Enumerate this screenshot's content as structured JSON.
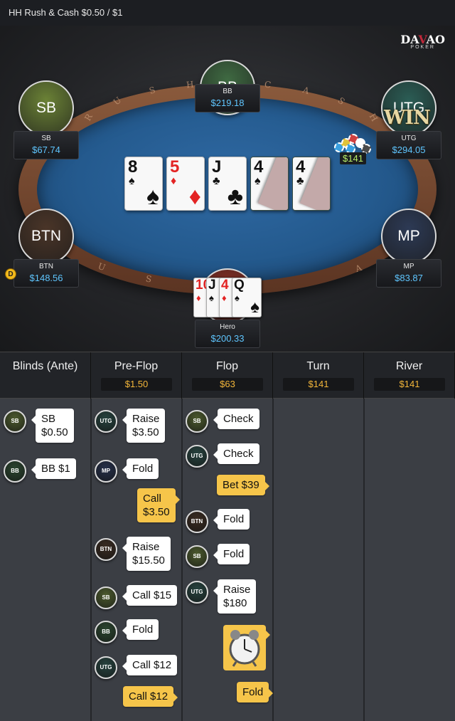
{
  "header": {
    "title": "HH  Rush & Cash $0.50 / $1"
  },
  "logo": {
    "brand_pre": "DA",
    "brand_o": "V",
    "brand_post": "AO",
    "subtitle": "POKER"
  },
  "table": {
    "rail_letters": [
      "R",
      "U",
      "S",
      "H",
      "&",
      "C",
      "A",
      "S",
      "H",
      "U",
      "S",
      "A"
    ],
    "seats": [
      {
        "id": "bb",
        "label": "BB",
        "name": "BB",
        "stack": "$219.18",
        "color": "#3f6a42"
      },
      {
        "id": "sb",
        "label": "SB",
        "name": "SB",
        "stack": "$67.74",
        "color": "#6b8236"
      },
      {
        "id": "utg",
        "label": "UTG",
        "name": "UTG",
        "stack": "$294.05",
        "color": "#2b5d55"
      },
      {
        "id": "btn",
        "label": "BTN",
        "name": "BTN",
        "stack": "$148.56",
        "color": "#4a3528"
      },
      {
        "id": "mp",
        "label": "MP",
        "name": "MP",
        "stack": "$83.87",
        "color": "#2d3a55"
      },
      {
        "id": "hero",
        "label": "",
        "name": "Hero",
        "stack": "$200.33",
        "color": "#8b2f25"
      }
    ],
    "win_text": "WIN",
    "dealer_button": "D",
    "pot_badge": "$141",
    "board": [
      {
        "rank": "8",
        "suit": "♠",
        "color": "black",
        "folded": false
      },
      {
        "rank": "5",
        "suit": "♦",
        "color": "red",
        "folded": false
      },
      {
        "rank": "J",
        "suit": "♣",
        "color": "black",
        "folded": false
      },
      {
        "rank": "4",
        "suit": "♠",
        "color": "black",
        "folded": true
      },
      {
        "rank": "4",
        "suit": "♣",
        "color": "black",
        "folded": true
      }
    ],
    "hero_cards": [
      {
        "rank": "10",
        "suit": "♦",
        "color": "red"
      },
      {
        "rank": "J",
        "suit": "♠",
        "color": "black"
      },
      {
        "rank": "4",
        "suit": "♦",
        "color": "red"
      },
      {
        "rank": "Q",
        "suit": "♠",
        "color": "black"
      }
    ]
  },
  "streets": [
    {
      "name": "Blinds (Ante)",
      "pot": ""
    },
    {
      "name": "Pre-Flop",
      "pot": "$1.50"
    },
    {
      "name": "Flop",
      "pot": "$63"
    },
    {
      "name": "Turn",
      "pot": "$141"
    },
    {
      "name": "River",
      "pot": "$141"
    }
  ],
  "actions": {
    "blinds": [
      {
        "player": "SB",
        "text1": "SB",
        "text2": "$0.50",
        "hero": false
      },
      {
        "player": "BB",
        "text1": "BB  $1",
        "text2": "",
        "hero": false
      }
    ],
    "preflop": [
      {
        "player": "UTG",
        "text1": "Raise",
        "text2": "$3.50",
        "hero": false
      },
      {
        "player": "MP",
        "text1": "Fold",
        "text2": "",
        "hero": false
      },
      {
        "player": "",
        "text1": "Call",
        "text2": "$3.50",
        "hero": true
      },
      {
        "player": "BTN",
        "text1": "Raise",
        "text2": "$15.50",
        "hero": false
      },
      {
        "player": "SB",
        "text1": "Call  $15",
        "text2": "",
        "hero": false
      },
      {
        "player": "BB",
        "text1": "Fold",
        "text2": "",
        "hero": false
      },
      {
        "player": "UTG",
        "text1": "Call  $12",
        "text2": "",
        "hero": false
      },
      {
        "player": "",
        "text1": "Call  $12",
        "text2": "",
        "hero": true
      }
    ],
    "flop": [
      {
        "player": "SB",
        "text1": "Check",
        "text2": "",
        "hero": false
      },
      {
        "player": "UTG",
        "text1": "Check",
        "text2": "",
        "hero": false
      },
      {
        "player": "",
        "text1": "Bet  $39",
        "text2": "",
        "hero": true
      },
      {
        "player": "BTN",
        "text1": "Fold",
        "text2": "",
        "hero": false
      },
      {
        "player": "SB",
        "text1": "Fold",
        "text2": "",
        "hero": false
      },
      {
        "player": "UTG",
        "text1": "Raise",
        "text2": "$180",
        "hero": false
      },
      {
        "player": "",
        "text1": "Fold",
        "text2": "",
        "hero": true
      }
    ]
  },
  "icons": {
    "timer": "alarm-clock-icon"
  }
}
